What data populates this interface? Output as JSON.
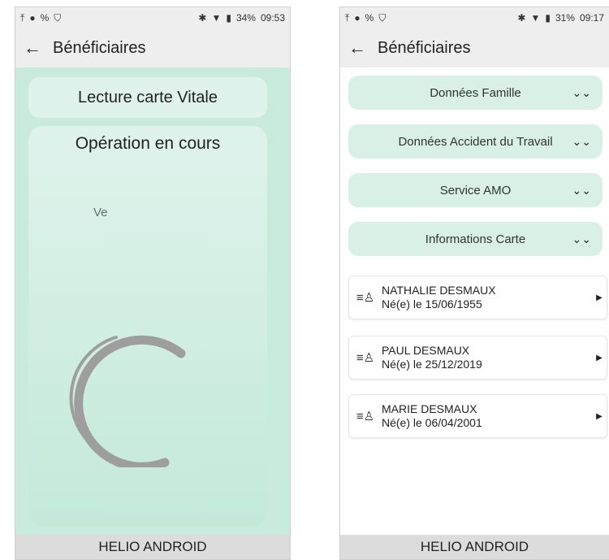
{
  "left": {
    "status": {
      "time": "09:53",
      "battery": "34%"
    },
    "title": "Bénéficiaires",
    "card_title": "Lecture carte Vitale",
    "operation_title": "Opération en cours",
    "operation_text": "Ve",
    "footer": "HELIO ANDROID"
  },
  "right": {
    "status": {
      "time": "09:17",
      "battery": "31%"
    },
    "title": "Bénéficiaires",
    "sections": [
      {
        "label": "Données Famille"
      },
      {
        "label": "Données Accident du Travail"
      },
      {
        "label": "Service AMO"
      },
      {
        "label": "Informations Carte"
      }
    ],
    "beneficiaries": [
      {
        "name": "NATHALIE DESMAUX",
        "birth": "Né(e) le  15/06/1955"
      },
      {
        "name": "PAUL DESMAUX",
        "birth": "Né(e) le  25/12/2019"
      },
      {
        "name": "MARIE DESMAUX",
        "birth": "Né(e) le  06/04/2001"
      }
    ],
    "footer": "HELIO ANDROID"
  },
  "colors": {
    "card_green": "#dff3ec",
    "content_green": "#c9ebde",
    "spinner": "#9e9e9e"
  }
}
